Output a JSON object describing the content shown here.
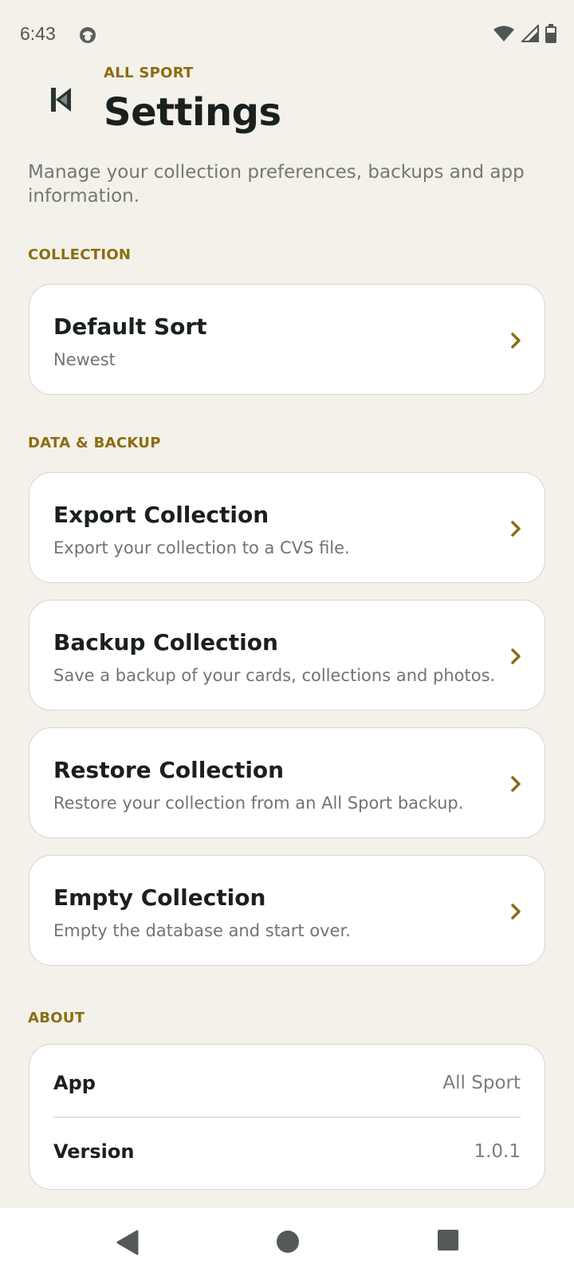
{
  "status": {
    "time": "6:43"
  },
  "header": {
    "eyebrow": "ALL SPORT",
    "title": "Settings",
    "description": "Manage your collection preferences, backups and app information."
  },
  "sections": {
    "collection": {
      "label": "COLLECTION",
      "items": [
        {
          "title": "Default Sort",
          "subtitle": "Newest"
        }
      ]
    },
    "data_backup": {
      "label": "DATA & BACKUP",
      "items": [
        {
          "title": "Export Collection",
          "subtitle": "Export your collection to a CVS file."
        },
        {
          "title": "Backup Collection",
          "subtitle": "Save a backup of your cards, collections and photos."
        },
        {
          "title": "Restore Collection",
          "subtitle": "Restore your collection from an All Sport backup."
        },
        {
          "title": "Empty Collection",
          "subtitle": "Empty the database and start over."
        }
      ]
    },
    "about": {
      "label": "ABOUT",
      "rows": [
        {
          "key": "App",
          "value": "All Sport"
        },
        {
          "key": "Version",
          "value": "1.0.1"
        }
      ]
    }
  },
  "colors": {
    "background": "#f4f1ea",
    "accent": "#8a6d12",
    "card": "#ffffff",
    "text": "#1a201d"
  },
  "icons": {
    "back": "skip-back-icon",
    "chevron": "chevron-right-icon",
    "wifi": "wifi-icon",
    "signal": "signal-icon",
    "battery": "battery-icon"
  }
}
